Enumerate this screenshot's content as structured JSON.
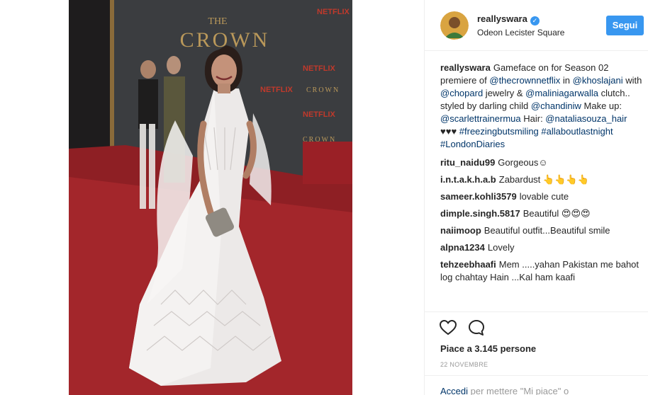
{
  "post": {
    "username": "reallyswara",
    "location": "Odeon Lecister Square",
    "follow_label": "Segui",
    "caption": {
      "username": "reallyswara",
      "parts": [
        {
          "t": "Gameface on for Season 02 premiere of ",
          "m": false
        },
        {
          "t": "@thecrownnetflix",
          "m": true
        },
        {
          "t": " in ",
          "m": false
        },
        {
          "t": "@khoslajani",
          "m": true
        },
        {
          "t": " with ",
          "m": false
        },
        {
          "t": "@chopard",
          "m": true
        },
        {
          "t": " jewelry & ",
          "m": false
        },
        {
          "t": "@maliniagarwalla",
          "m": true
        },
        {
          "t": " clutch.. styled by darling child ",
          "m": false
        },
        {
          "t": "@chandiniw",
          "m": true
        },
        {
          "t": " Make up: ",
          "m": false
        },
        {
          "t": "@scarlettrainermua",
          "m": true
        },
        {
          "t": " Hair: ",
          "m": false
        },
        {
          "t": "@nataliasouza_hair",
          "m": true
        },
        {
          "t": " ♥♥♥ ",
          "m": false
        },
        {
          "t": "#freezingbutsmiling",
          "m": true
        },
        {
          "t": " ",
          "m": false
        },
        {
          "t": "#allaboutlastnight",
          "m": true
        },
        {
          "t": " ",
          "m": false
        },
        {
          "t": "#LondonDiaries",
          "m": true
        }
      ]
    },
    "comments": [
      {
        "user": "ritu_naidu99",
        "text": "Gorgeous☺"
      },
      {
        "user": "i.n.t.a.k.h.a.b",
        "text": "Zabardust 👆👆👆👆"
      },
      {
        "user": "sameer.kohli3579",
        "text": "lovable cute"
      },
      {
        "user": "dimple.singh.5817",
        "text": "Beautiful 😍😍😍"
      },
      {
        "user": "naiimoop",
        "text": "Beautiful outfit...Beautiful smile"
      },
      {
        "user": "alpna1234",
        "text": "Lovely"
      },
      {
        "user": "tehzeebhaafi",
        "text": "Mem .....yahan Pakistan me bahot log chahtay Hain ...Kal ham kaafi"
      }
    ],
    "likes_text": "Piace a 3.145 persone",
    "date": "22 NOVEMBRE",
    "login_link": "Accedi",
    "login_rest": " per mettere \"Mi piace\" o"
  },
  "photo": {
    "backdrop_words": [
      "THE",
      "CROWN",
      "NETFLIX"
    ]
  },
  "icons": {
    "like": "heart-outline-icon",
    "comment": "comment-bubble-icon",
    "verified": "verified-check-icon"
  },
  "colors": {
    "accent": "#3897f0",
    "link": "#003569",
    "carpet": "#a3262b",
    "backdrop": "#3b3d40"
  }
}
